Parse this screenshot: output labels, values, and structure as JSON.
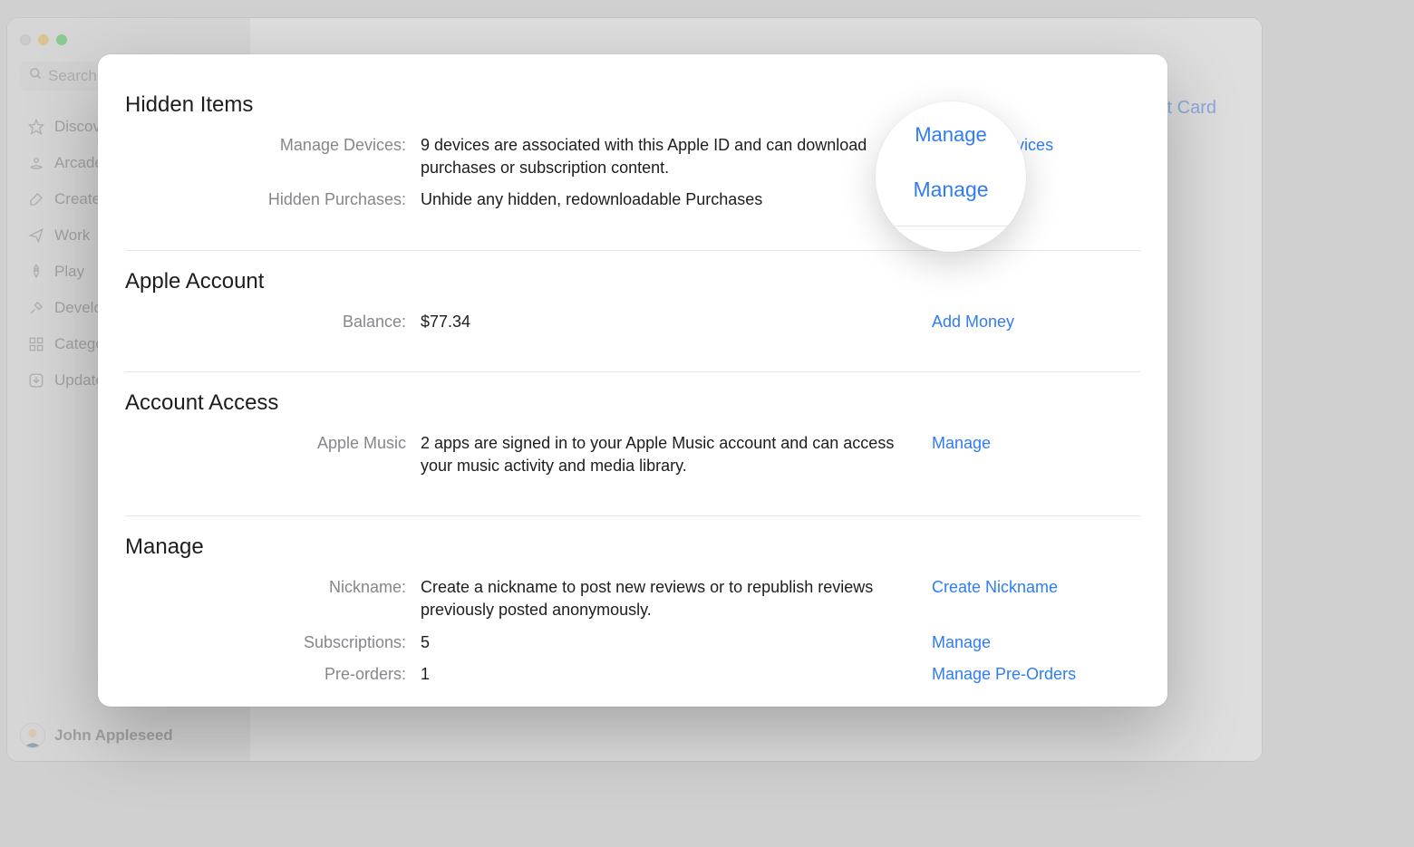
{
  "sidebar": {
    "search_placeholder": "Search",
    "items": [
      {
        "label": "Discover",
        "icon": "star"
      },
      {
        "label": "Arcade",
        "icon": "arcade"
      },
      {
        "label": "Create",
        "icon": "brush"
      },
      {
        "label": "Work",
        "icon": "plane"
      },
      {
        "label": "Play",
        "icon": "rocket"
      },
      {
        "label": "Develop",
        "icon": "hammer"
      },
      {
        "label": "Categories",
        "icon": "grid"
      },
      {
        "label": "Updates",
        "icon": "download"
      }
    ],
    "user_name": "John Appleseed"
  },
  "header": {
    "card_partial": "t Card"
  },
  "modal": {
    "sections": {
      "hidden_items": {
        "title": "Hidden Items",
        "rows": [
          {
            "label": "Manage Devices:",
            "value": "9 devices are associated with this Apple ID and can download purchases or subscription content.",
            "action": "Manage Devices"
          },
          {
            "label": "Hidden Purchases:",
            "value": "Unhide any hidden, redownloadable Purchases",
            "action": ""
          }
        ]
      },
      "apple_account": {
        "title": "Apple Account",
        "rows": [
          {
            "label": "Balance:",
            "value": "$77.34",
            "action": "Add Money"
          }
        ]
      },
      "account_access": {
        "title": "Account Access",
        "rows": [
          {
            "label": "Apple Music",
            "value": "2 apps are signed in to your Apple Music account and can access your music activity and media library.",
            "action": "Manage"
          }
        ]
      },
      "manage": {
        "title": "Manage",
        "rows": [
          {
            "label": "Nickname:",
            "value": "Create a nickname to post new reviews or to republish reviews previously posted anonymously.",
            "action": "Create Nickname"
          },
          {
            "label": "Subscriptions:",
            "value": "5",
            "action": "Manage"
          },
          {
            "label": "Pre-orders:",
            "value": "1",
            "action": "Manage Pre-Orders"
          }
        ]
      }
    }
  },
  "magnifier": {
    "top_text": "Manage",
    "main_text": "Manage"
  }
}
